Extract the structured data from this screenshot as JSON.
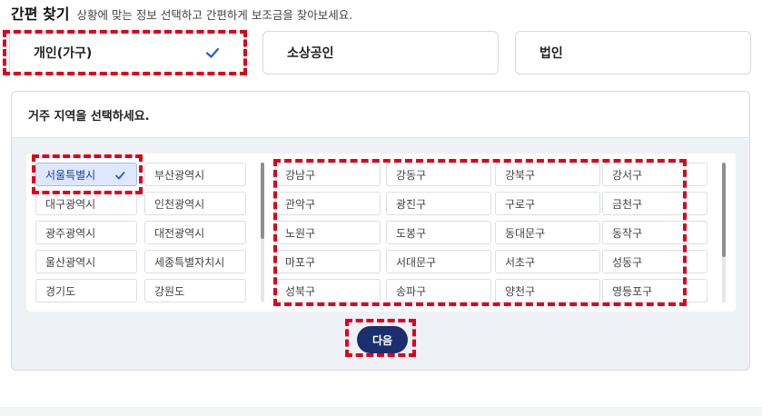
{
  "header": {
    "title": "간편 찾기",
    "subtitle": "상황에 맞는 정보 선택하고 간편하게 보조금을 찾아보세요."
  },
  "categories": [
    {
      "label": "개인(가구)",
      "selected": true
    },
    {
      "label": "소상공인",
      "selected": false
    },
    {
      "label": "법인",
      "selected": false
    }
  ],
  "region": {
    "heading": "거주 지역을 선택하세요.",
    "provinces": [
      {
        "label": "서울특별시",
        "selected": true
      },
      {
        "label": "부산광역시",
        "selected": false
      },
      {
        "label": "대구광역시",
        "selected": false
      },
      {
        "label": "인천광역시",
        "selected": false
      },
      {
        "label": "광주광역시",
        "selected": false
      },
      {
        "label": "대전광역시",
        "selected": false
      },
      {
        "label": "울산광역시",
        "selected": false
      },
      {
        "label": "세종특별자치시",
        "selected": false
      },
      {
        "label": "경기도",
        "selected": false
      },
      {
        "label": "강원도",
        "selected": false
      }
    ],
    "districts": [
      "강남구",
      "강동구",
      "강북구",
      "강서구",
      "관악구",
      "광진구",
      "구로구",
      "금천구",
      "노원구",
      "도봉구",
      "동대문구",
      "동작구",
      "마포구",
      "서대문구",
      "서초구",
      "성동구",
      "성북구",
      "송파구",
      "양천구",
      "영등포구"
    ],
    "next_label": "다음"
  },
  "colors": {
    "accent": "#1b2f6e",
    "selected_bg": "#dde8ff",
    "check": "#2a5bd7",
    "highlight": "#e0001b",
    "panel_bg": "#eef1f6"
  },
  "icons": {
    "check": "check-icon"
  }
}
